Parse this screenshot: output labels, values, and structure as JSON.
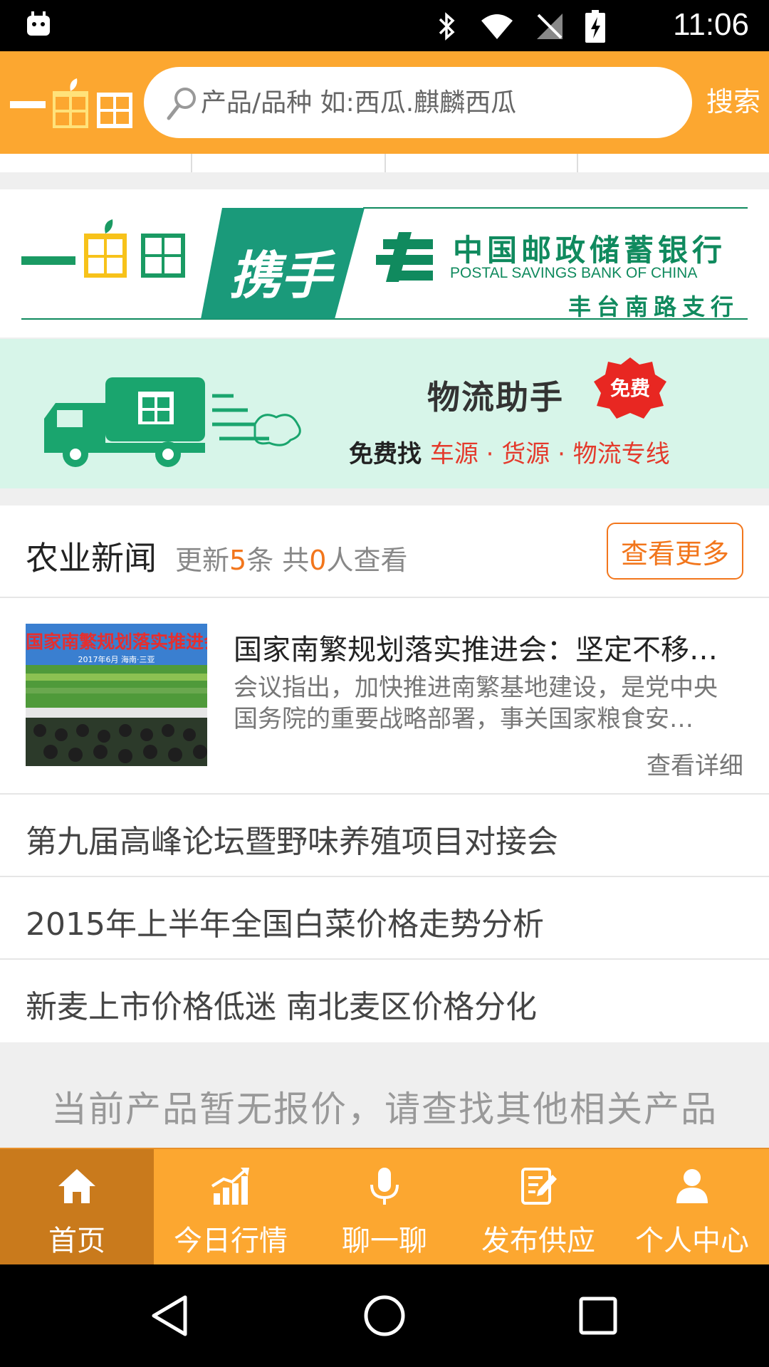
{
  "status_bar": {
    "time": "11:06"
  },
  "header": {
    "search_placeholder": "产品/品种 如:西瓜.麒麟西瓜",
    "search_button": "搜索"
  },
  "banners": {
    "postal": {
      "handshake": "携手",
      "bank_name_cn": "中国邮政储蓄银行",
      "bank_name_en": "POSTAL SAVINGS BANK OF CHINA",
      "branch": "丰台南路支行"
    },
    "logistics": {
      "title": "物流助手",
      "badge": "免费",
      "line_prefix": "免费找",
      "line_items": "车源 · 货源 · 物流专线"
    }
  },
  "news": {
    "title": "农业新闻",
    "meta_prefix": "更新",
    "meta_count": "5",
    "meta_mid": "条 共",
    "meta_views": "0",
    "meta_suffix": "人查看",
    "more_button": "查看更多",
    "feature": {
      "image_caption": "国家南繁规划落实推进会",
      "image_sub": "2017年6月  海南·三亚",
      "title": "国家南繁规划落实推进会：坚定不移…",
      "desc": "会议指出，加快推进南繁基地建设，是党中央国务院的重要战略部署，事关国家粮食安…",
      "link": "查看详细"
    },
    "items": [
      "第九届高峰论坛暨野味养殖项目对接会",
      "2015年上半年全国白菜价格走势分析",
      "新麦上市价格低迷 南北麦区价格分化"
    ]
  },
  "notice": "当前产品暂无报价，请查找其他相关产品",
  "tabs": [
    {
      "label": "首页",
      "icon": "home-icon",
      "active": true
    },
    {
      "label": "今日行情",
      "icon": "chart-icon",
      "active": false
    },
    {
      "label": "聊一聊",
      "icon": "microphone-icon",
      "active": false
    },
    {
      "label": "发布供应",
      "icon": "edit-icon",
      "active": false
    },
    {
      "label": "个人中心",
      "icon": "user-icon",
      "active": false
    }
  ],
  "colors": {
    "brand_orange": "#fca730",
    "active_tab": "#c97a1c",
    "highlight": "#f2761c",
    "postal_green": "#108a5e"
  }
}
